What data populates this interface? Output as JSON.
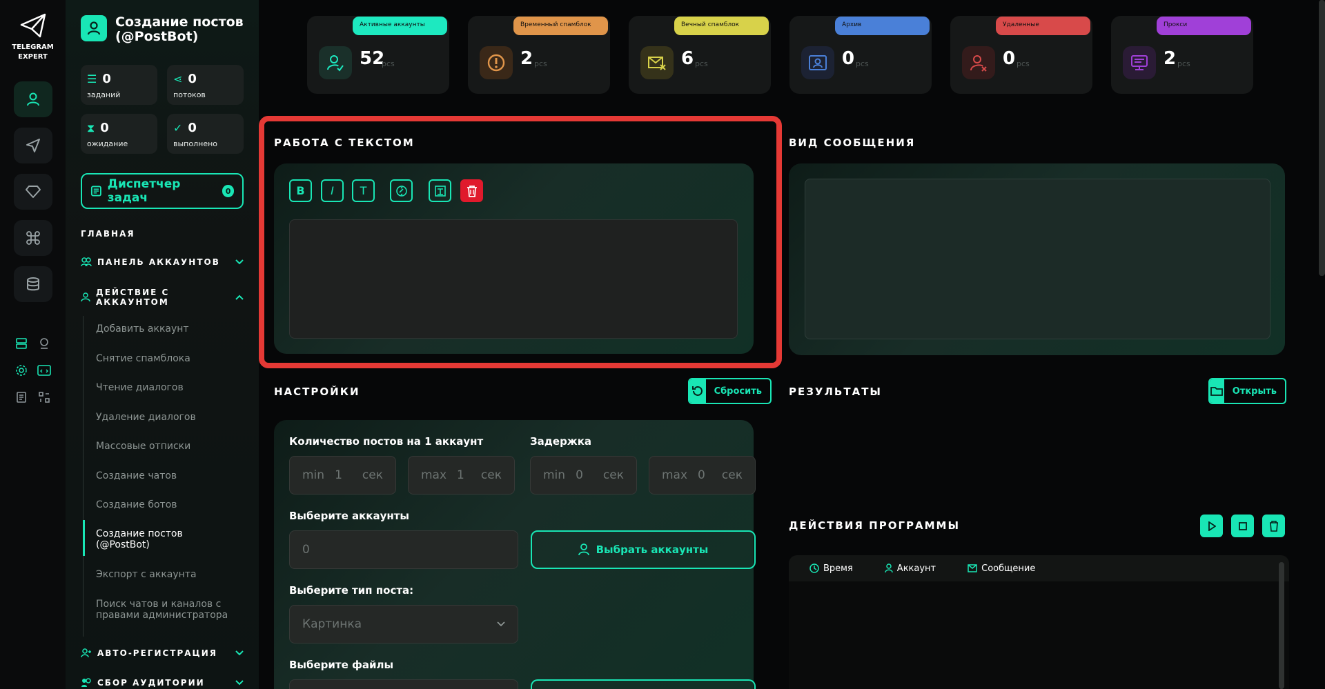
{
  "app": {
    "logo_line1": "TELEGRAM",
    "logo_line2": "EXPERT",
    "title": "Создание постов (@PostBot)"
  },
  "stats": [
    {
      "value": "0",
      "label": "заданий"
    },
    {
      "value": "0",
      "label": "потоков"
    },
    {
      "value": "0",
      "label": "ожидание"
    },
    {
      "value": "0",
      "label": "выполнено"
    }
  ],
  "dispatcher": {
    "label": "Диспетчер задач",
    "count": "0"
  },
  "sidebar": {
    "main_heading": "ГЛАВНАЯ",
    "account_panel": "ПАНЕЛЬ АККАУНТОВ",
    "account_actions": "ДЕЙСТВИЕ С АККАУНТОМ",
    "items": [
      "Добавить аккаунт",
      "Снятие спамблока",
      "Чтение диалогов",
      "Удаление диалогов",
      "Массовые отписки",
      "Создание чатов",
      "Создание ботов",
      "Создание постов (@PostBot)",
      "Экспорт с аккаунта",
      "Поиск чатов и каналов с правами администратора"
    ],
    "auto_reg": "АВТО-РЕГИСТРАЦИЯ",
    "audience": "СБОР АУДИТОРИИ"
  },
  "cards": [
    {
      "tag": "Активные аккаунты",
      "value": "52",
      "unit": "pcs",
      "color": "#1de9c0"
    },
    {
      "tag": "Временный спамблок",
      "value": "2",
      "unit": "pcs",
      "color": "#e0954a"
    },
    {
      "tag": "Вечный спамблок",
      "value": "6",
      "unit": "pcs",
      "color": "#d8d24a"
    },
    {
      "tag": "Архив",
      "value": "0",
      "unit": "pcs",
      "color": "#4a80d8"
    },
    {
      "tag": "Удаленные",
      "value": "0",
      "unit": "pcs",
      "color": "#d84a4a"
    },
    {
      "tag": "Прокси",
      "value": "2",
      "unit": "pcs",
      "color": "#a040d8"
    }
  ],
  "text_section": {
    "title": "РАБОТА С ТЕКСТОМ",
    "bold": "B",
    "italic": "I",
    "mono": "T"
  },
  "preview": {
    "title": "ВИД СООБЩЕНИЯ"
  },
  "settings": {
    "title": "НАСТРОЙКИ",
    "reset": "Сбросить",
    "posts_label": "Количество постов на 1 аккаунт",
    "delay_label": "Задержка",
    "min": "min",
    "max": "max",
    "sec": "сек",
    "posts_min": "1",
    "posts_max": "1",
    "delay_min": "0",
    "delay_max": "0",
    "accounts_label": "Выберите аккаунты",
    "accounts_value": "0",
    "choose_accounts": "Выбрать аккаунты",
    "post_type_label": "Выберите тип поста:",
    "post_type_value": "Картинка",
    "files_label": "Выберите файлы"
  },
  "results": {
    "title": "РЕЗУЛЬТАТЫ",
    "open": "Открыть"
  },
  "log": {
    "title": "ДЕЙСТВИЯ ПРОГРАММЫ",
    "col_time": "Время",
    "col_account": "Аккаунт",
    "col_message": "Сообщение"
  }
}
